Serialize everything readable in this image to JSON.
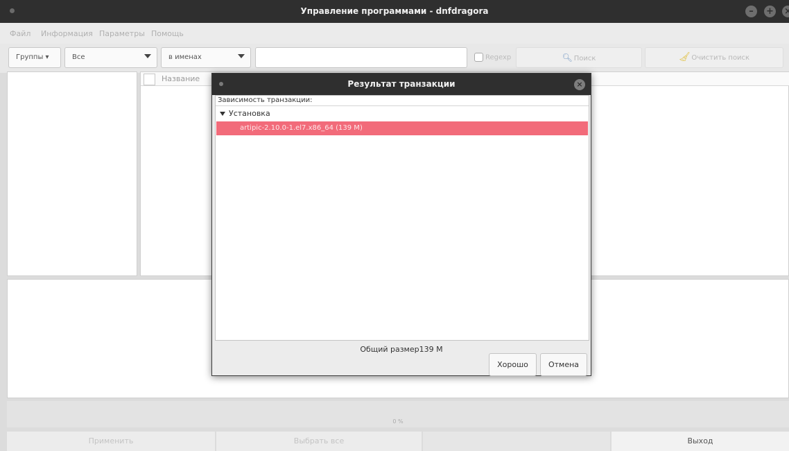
{
  "window": {
    "title": "Управление программами - dnfdragora",
    "menu": [
      "Файл",
      "Информация",
      "Параметры",
      "Помощь"
    ]
  },
  "toolbar": {
    "groups_label": "Группы ▾",
    "filter_value": "Все",
    "search_scope_value": "в именах",
    "search_value": "",
    "regexp_label": "Regexp",
    "search_button": "Поиск",
    "clear_button": "Очистить поиск"
  },
  "list": {
    "column_name": "Название"
  },
  "progress": {
    "text": "0 %"
  },
  "bottom": {
    "apply": "Применить",
    "select_all": "Выбрать все",
    "exit": "Выход"
  },
  "dialog": {
    "title": "Результат транзакции",
    "header": "Зависимость транзакции:",
    "group": "Установка",
    "item": "artipic-2.10.0-1.el7.x86_64 (139 M)",
    "total": "Общий размер139 M",
    "ok": "Хорошо",
    "cancel": "Отмена"
  },
  "colors": {
    "selection": "#f26b7a",
    "titlebar": "#2f2f2f"
  }
}
